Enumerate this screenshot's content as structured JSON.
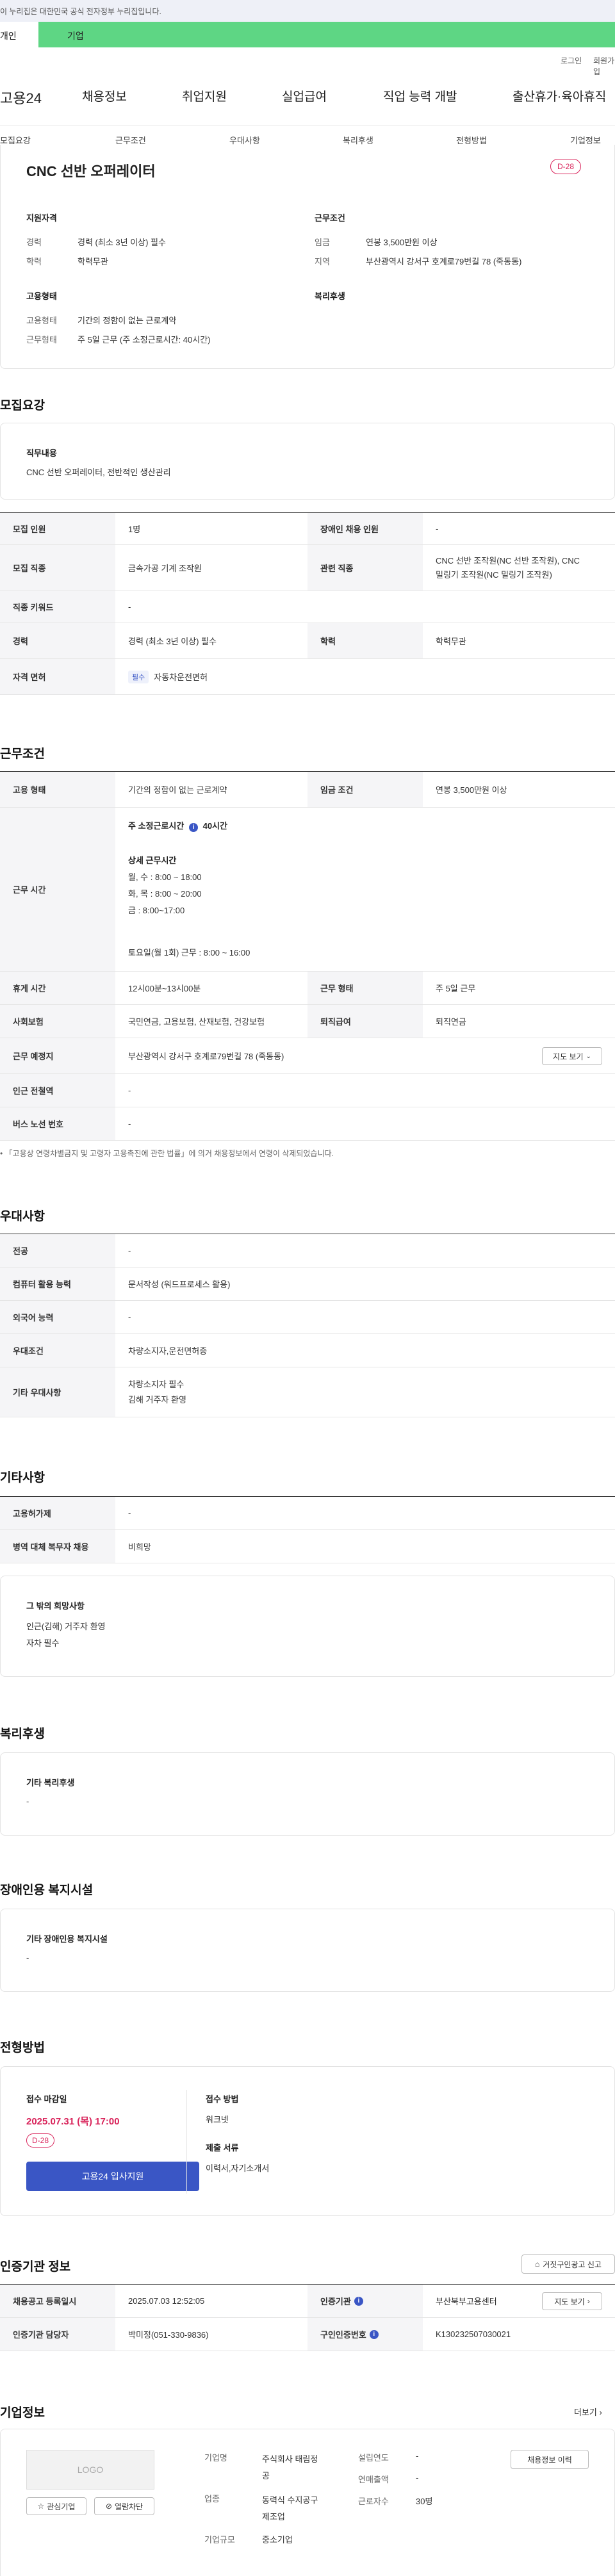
{
  "gov_banner": "이 누리집은 대한민국 공식 전자정부 누리집입니다.",
  "tabs": [
    "개인",
    "기업"
  ],
  "util": {
    "login": "로그인",
    "join": "회원가입"
  },
  "gnb": {
    "logo": "고용24",
    "items": [
      "채용정보",
      "취업지원",
      "실업급여",
      "직업 능력 개발",
      "출산휴가·육아휴직"
    ]
  },
  "subnav": [
    "모집요강",
    "근무조건",
    "우대사항",
    "복리후생",
    "전형방법",
    "기업정보"
  ],
  "summary": {
    "title": "CNC 선반 오퍼레이터",
    "dday": "D-28",
    "left_title": "지원자격",
    "career_lbl": "경력",
    "career": "경력 (최소 3년 이상) 필수",
    "edu_lbl": "학력",
    "edu": "학력무관",
    "right_title": "근무조건",
    "wage_lbl": "임금",
    "wage": "연봉 3,500만원 이상",
    "region_lbl": "지역",
    "region": "부산광역시 강서구 호계로79번길 78 (죽동동)",
    "emp_title": "고용형태",
    "emp_lbl": "고용형태",
    "emp": "기간의 정함이 없는 근로계약",
    "hours_lbl": "근무형태",
    "hours": "주 5일 근무 (주 소정근로시간: 40시간)",
    "welfare_title": "복리후생"
  },
  "recruit": {
    "title": "모집요강",
    "duty_title": "직무내용",
    "duty": "CNC 선반 오퍼레이터, 전반적인 생산관리",
    "rows": {
      "headcount_lbl": "모집 인원",
      "headcount": "1명",
      "disabled_lbl": "장애인 채용 인원",
      "disabled": "-",
      "job_lbl": "모집 직종",
      "job": "금속가공 기계 조작원",
      "rel_lbl": "관련 직종",
      "rel1": "CNC 선반 조작원(NC 선반 조작원), CNC",
      "rel2": "밀링기 조작원(NC 밀링기 조작원)",
      "kw_lbl": "직종 키워드",
      "kw": "-",
      "career_lbl": "경력",
      "career": "경력 (최소 3년 이상) 필수",
      "edu_lbl": "학력",
      "edu": "학력무관",
      "lic_lbl": "자격 면허",
      "lic_tag": "필수",
      "lic": "자동차운전면허"
    }
  },
  "cond": {
    "title": "근무조건",
    "emp_lbl": "고용 형태",
    "emp": "기간의 정함이 없는 근로계약",
    "wage_lbl": "임금 조건",
    "wage": "연봉 3,500만원 이상",
    "time_lbl": "근무 시간",
    "time_head": "주 소정근로시간",
    "time_total": "40시간",
    "detail_head": "상세 근무시간",
    "d1": "월, 수 : 8:00 ~ 18:00",
    "d2": "화, 목 : 8:00 ~ 20:00",
    "d3": "금 : 8:00~17:00",
    "d4": "토요일(월 1회) 근무 : 8:00 ~ 16:00",
    "rest_lbl": "휴게 시간",
    "rest": "12시00분~13시00분",
    "type_lbl": "근무 형태",
    "type": "주 5일 근무",
    "ins_lbl": "사회보험",
    "ins": "국민연금, 고용보험, 산재보험, 건강보험",
    "ret_lbl": "퇴직급여",
    "ret": "퇴직연금",
    "place_lbl": "근무 예정지",
    "place": "부산광역시 강서구 호계로79번길 78 (죽동동)",
    "map_btn": "지도 보기",
    "subway_lbl": "인근 전철역",
    "subway": "-",
    "bus_lbl": "버스 노선 번호",
    "bus": "-",
    "note": "「고용상 연령차별금지 및 고령자 고용촉진에 관한 법률」에 의거 채용정보에서 연령이 삭제되었습니다."
  },
  "pref": {
    "title": "우대사항",
    "major_lbl": "전공",
    "major": "-",
    "pc_lbl": "컴퓨터 활용 능력",
    "pc": "문서작성 (워드프로세스 활용)",
    "lang_lbl": "외국어 능력",
    "lang": "-",
    "cond_lbl": "우대조건",
    "cond": "차량소지자,운전면허증",
    "etc_lbl": "기타 우대사항",
    "etc1": "차량소지자 필수",
    "etc2": "김해 거주자 환영"
  },
  "other": {
    "title": "기타사항",
    "sup_lbl": "고용허가제",
    "sup": "-",
    "mil_lbl": "병역 대체 복무자 채용",
    "mil": "비희망",
    "box_title": "그 밖의 희망사항",
    "box1": "인근(김해) 거주자 환영",
    "box2": "자차 필수"
  },
  "welfare": {
    "title": "복리후생",
    "box_title": "기타 복리후생",
    "box_val": "-"
  },
  "disab": {
    "title": "장애인용 복지시설",
    "box_title": "기타 장애인용 복지시설",
    "box_val": "-"
  },
  "process": {
    "title": "전형방법",
    "deadline_lbl": "접수 마감일",
    "deadline": "2025.07.31 (목) 17:00",
    "dday": "D-28",
    "apply_btn": "고용24 입사지원",
    "method_lbl": "접수 방법",
    "method": "워크넷",
    "docs_lbl": "제출 서류",
    "docs": "이력서,자기소개서"
  },
  "agency": {
    "title": "인증기관 정보",
    "report_btn": "거짓구인광고 신고",
    "reg_lbl": "채용공고 등록일시",
    "reg": "2025.07.03 12:52:05",
    "org_lbl": "인증기관",
    "org": "부산북부고용센터",
    "map_btn": "지도 보기",
    "mgr_lbl": "인증기관 담당자",
    "mgr": "박미정(051-330-9836)",
    "no_lbl": "구인인증번호",
    "no": "K130232507030021"
  },
  "company": {
    "title": "기업정보",
    "more": "더보기",
    "logo": "LOGO",
    "fav_btn": "관심기업",
    "block_btn": "열람차단",
    "name_lbl": "기업명",
    "name1": "주식회사 태림정",
    "name2": "공",
    "ind_lbl": "업종",
    "ind1": "동력식 수지공구",
    "ind2": "제조업",
    "size_lbl": "기업규모",
    "size": "중소기업",
    "est_lbl": "설립연도",
    "est": "-",
    "sales_lbl": "연매출액",
    "sales": "-",
    "emp_lbl": "근로자수",
    "emp": "30명",
    "hist_btn": "채용정보 이력"
  }
}
